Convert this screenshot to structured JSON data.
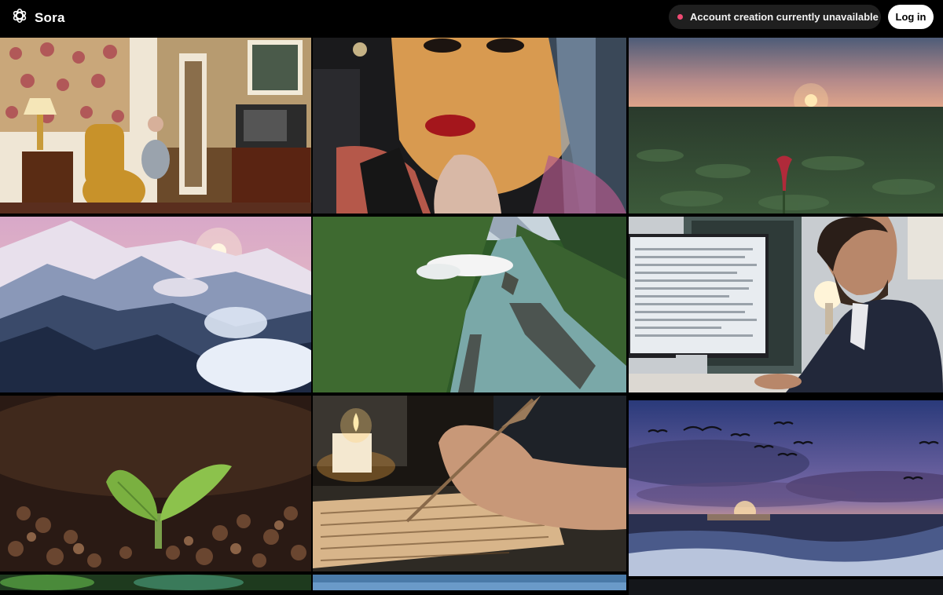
{
  "header": {
    "brand_name": "Sora",
    "brand_icon": "openai-logo-icon",
    "status_text": "Account creation currently unavailable",
    "status_color": "#ef4a73",
    "login_label": "Log in"
  },
  "gallery": {
    "tiles": [
      {
        "id": "tile-living-room-man"
      },
      {
        "id": "tile-woman-closeup"
      },
      {
        "id": "tile-sunset-field-tulip"
      },
      {
        "id": "tile-snowy-mountains"
      },
      {
        "id": "tile-river-valley"
      },
      {
        "id": "tile-man-at-computer"
      },
      {
        "id": "tile-seedling"
      },
      {
        "id": "tile-hand-writing-candle"
      },
      {
        "id": "tile-ocean-birds-sunset"
      }
    ]
  }
}
